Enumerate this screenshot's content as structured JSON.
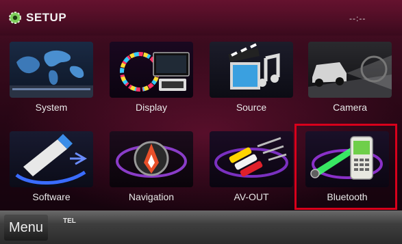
{
  "header": {
    "title": "SETUP",
    "clock": "--:--"
  },
  "tiles": [
    {
      "label": "System",
      "icon": "world-map-icon"
    },
    {
      "label": "Display",
      "icon": "display-icon"
    },
    {
      "label": "Source",
      "icon": "clapperboard-music-icon"
    },
    {
      "label": "Camera",
      "icon": "car-camera-icon"
    },
    {
      "label": "Software",
      "icon": "usb-drive-icon"
    },
    {
      "label": "Navigation",
      "icon": "compass-icon"
    },
    {
      "label": "AV-OUT",
      "icon": "av-cable-icon"
    },
    {
      "label": "Bluetooth",
      "icon": "phone-bluetooth-icon"
    }
  ],
  "highlighted_tile": "Bluetooth",
  "footer": {
    "menu_label": "Menu",
    "tel_label": "TEL"
  },
  "colors": {
    "highlight": "#d8001b",
    "accent": "#a4133f"
  }
}
